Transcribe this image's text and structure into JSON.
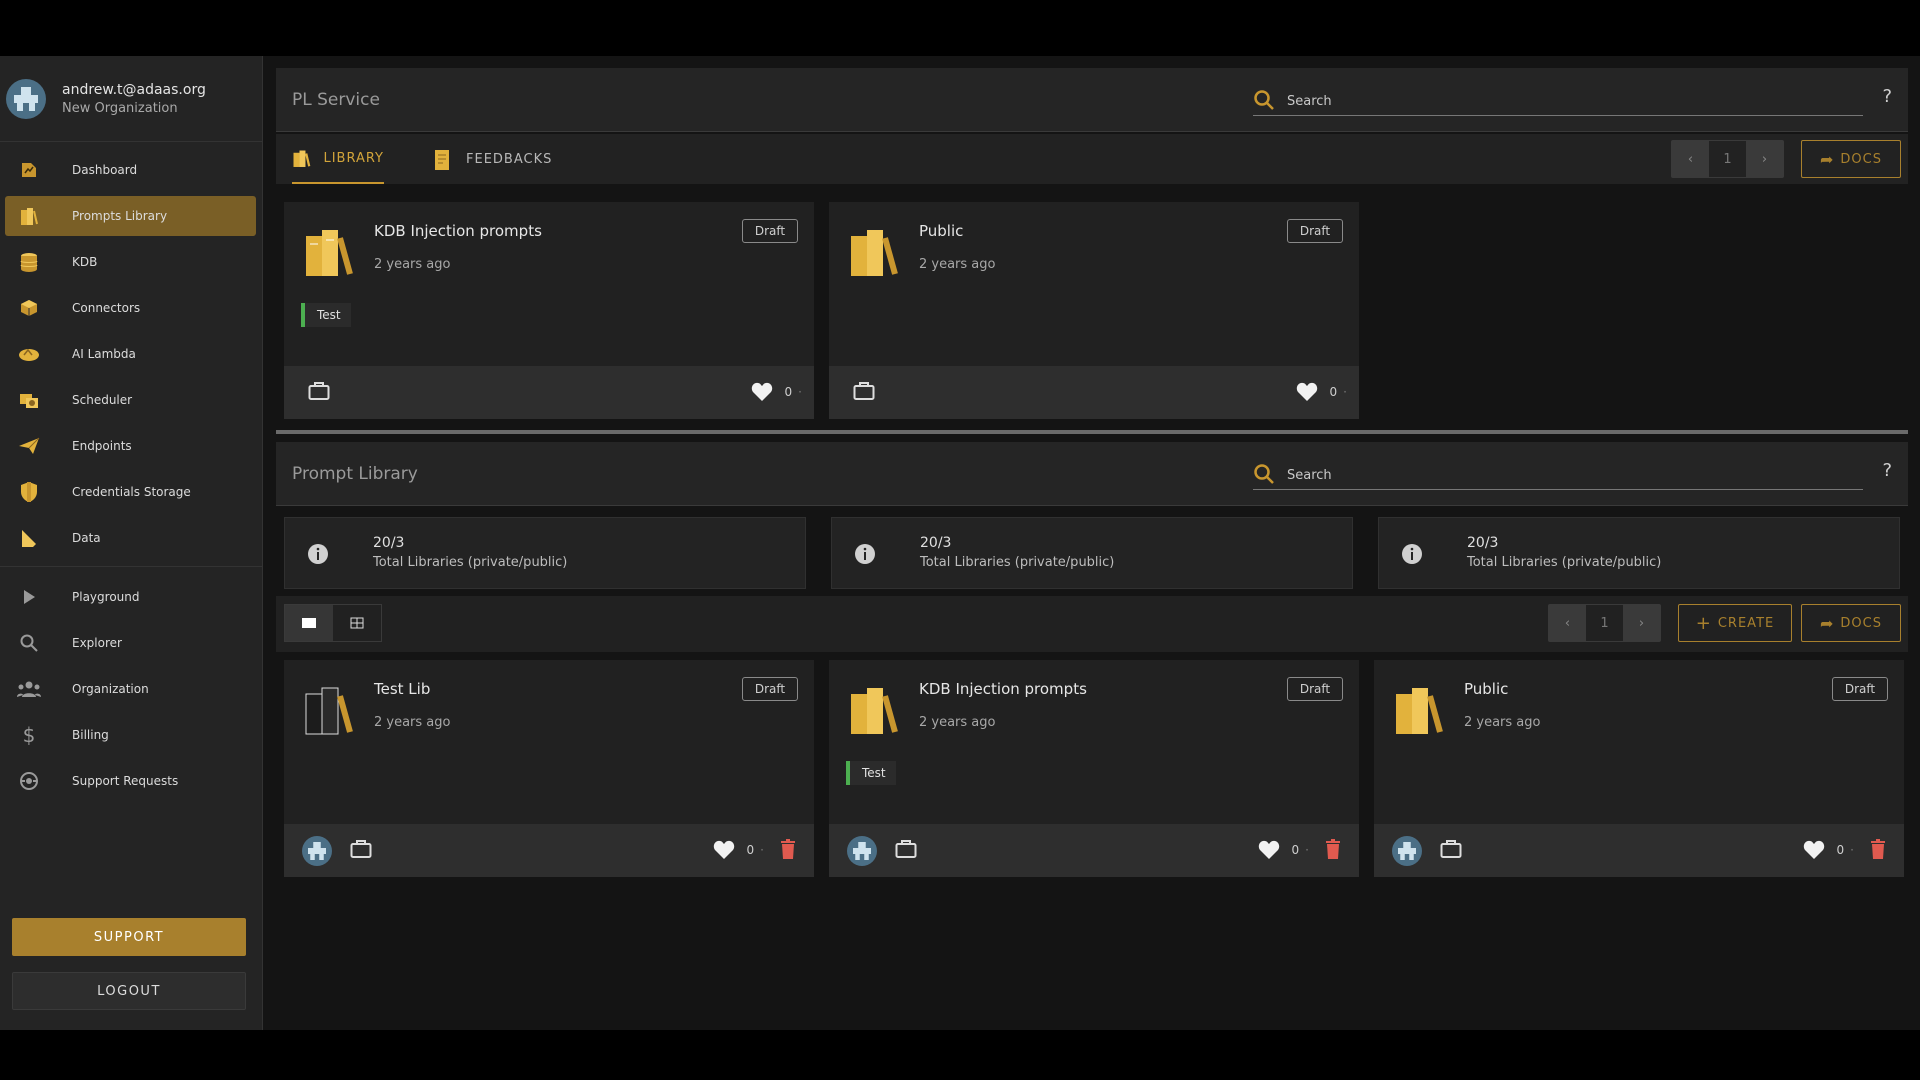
{
  "user": {
    "email": "andrew.t@adaas.org",
    "organization": "New Organization"
  },
  "sidebar": {
    "items": [
      {
        "label": "Dashboard",
        "icon": "dashboard-icon"
      },
      {
        "label": "Prompts Library",
        "icon": "books-icon",
        "active": true
      },
      {
        "label": "KDB",
        "icon": "database-icon"
      },
      {
        "label": "Connectors",
        "icon": "cube-icon"
      },
      {
        "label": "AI Lambda",
        "icon": "lambda-icon"
      },
      {
        "label": "Scheduler",
        "icon": "scheduler-icon"
      },
      {
        "label": "Endpoints",
        "icon": "paper-plane-icon"
      },
      {
        "label": "Credentials Storage",
        "icon": "shield-icon"
      },
      {
        "label": "Data",
        "icon": "data-icon"
      }
    ],
    "secondary": [
      {
        "label": "Playground",
        "icon": "play-icon"
      },
      {
        "label": "Explorer",
        "icon": "search-icon"
      },
      {
        "label": "Organization",
        "icon": "people-icon"
      },
      {
        "label": "Billing",
        "icon": "dollar-icon"
      },
      {
        "label": "Support Requests",
        "icon": "support-icon"
      }
    ],
    "support_label": "SUPPORT",
    "logout_label": "LOGOUT"
  },
  "service": {
    "title": "PL Service",
    "search_placeholder": "Search",
    "help": "?",
    "tabs": [
      {
        "label": "LIBRARY",
        "active": true
      },
      {
        "label": "FEEDBACKS"
      }
    ],
    "page": "1",
    "docs_label": "DOCS",
    "cards": [
      {
        "name": "KDB Injection prompts",
        "time": "2 years ago",
        "status": "Draft",
        "tag": "Test",
        "likes": "0"
      },
      {
        "name": "Public",
        "time": "2 years ago",
        "status": "Draft",
        "likes": "0"
      }
    ]
  },
  "library": {
    "title": "Prompt Library",
    "search_placeholder": "Search",
    "help": "?",
    "stats": [
      {
        "value": "20/3",
        "label": "Total Libraries (private/public)"
      },
      {
        "value": "20/3",
        "label": "Total Libraries (private/public)"
      },
      {
        "value": "20/3",
        "label": "Total Libraries (private/public)"
      }
    ],
    "page": "1",
    "create_label": "CREATE",
    "docs_label": "DOCS",
    "cards": [
      {
        "name": "Test Lib",
        "time": "2 years ago",
        "status": "Draft",
        "likes": "0"
      },
      {
        "name": "KDB Injection prompts",
        "time": "2 years ago",
        "status": "Draft",
        "tag": "Test",
        "likes": "0"
      },
      {
        "name": "Public",
        "time": "2 years ago",
        "status": "Draft",
        "likes": "0"
      }
    ]
  },
  "colors": {
    "accent": "#a8802d",
    "active_nav": "#7a5f26",
    "tag_bar": "#4caf50",
    "trash": "#e05a4f"
  }
}
